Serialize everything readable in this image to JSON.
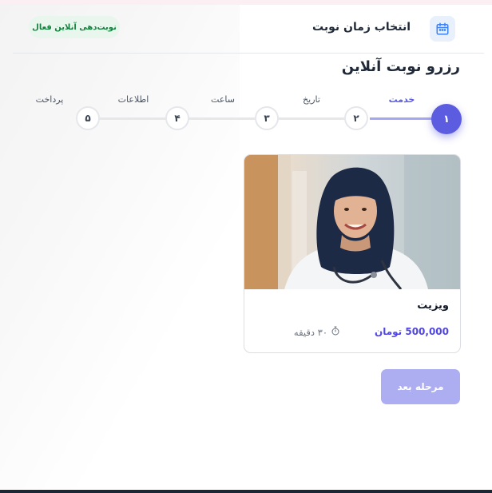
{
  "header": {
    "title": "انتخاب زمان نوبت",
    "status_badge": "نوبت‌دهی آنلاین فعال",
    "icon": "calendar-icon"
  },
  "page_title": "رزرو نوبت آنلاین",
  "stepper": {
    "current": 1,
    "steps": [
      {
        "number": "۱",
        "label": "خدمت"
      },
      {
        "number": "۲",
        "label": "تاریخ"
      },
      {
        "number": "۳",
        "label": "ساعت"
      },
      {
        "number": "۴",
        "label": "اطلاعات"
      },
      {
        "number": "۵",
        "label": "پرداخت"
      }
    ]
  },
  "service": {
    "name": "ویزیت",
    "price": "500,000 تومان",
    "duration": "۳۰ دقیقه",
    "duration_icon": "stopwatch-icon",
    "image": "doctor-photo"
  },
  "next_button": "مرحله بعد",
  "colors": {
    "accent": "#5b5ce0",
    "price": "#4f46e5",
    "badge_bg": "#e8f6ee",
    "badge_text": "#15803d",
    "button_disabled": "#adadf2"
  }
}
